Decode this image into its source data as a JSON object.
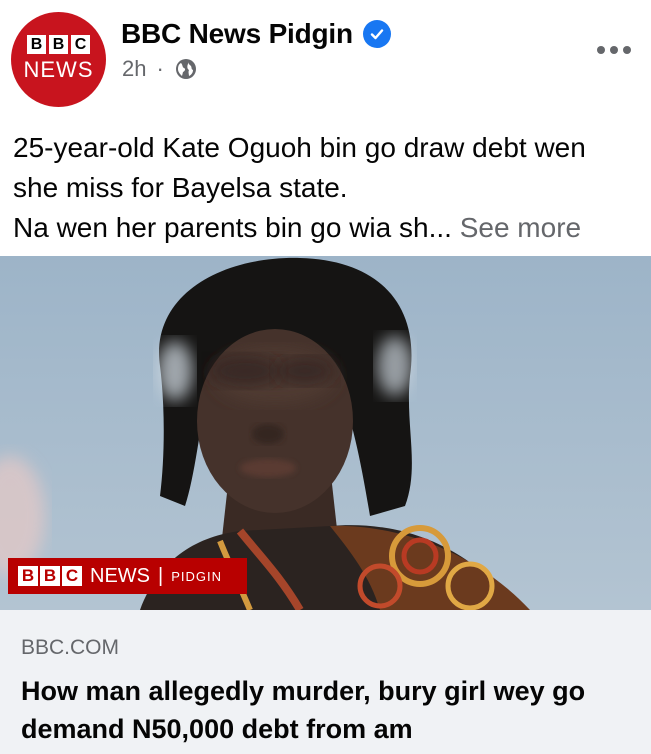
{
  "post": {
    "avatar": {
      "blocks": [
        "B",
        "B",
        "C"
      ],
      "news_text": "NEWS"
    },
    "page_name": "BBC News Pidgin",
    "time": "2h",
    "separator": "·",
    "privacy_icon": "globe-icon",
    "verified_icon": "verified-badge-icon",
    "more_icon": "more-options-icon",
    "text_lines": [
      "25-year-old Kate Oguoh bin go draw debt wen",
      "she miss for Bayelsa state.",
      "Na wen her parents bin go wia sh..."
    ],
    "see_more": "See more"
  },
  "media": {
    "overlay": {
      "blocks": [
        "B",
        "B",
        "C"
      ],
      "news": "NEWS",
      "divider": "|",
      "sub": "PIDGIN"
    }
  },
  "link_card": {
    "domain": "BBC.COM",
    "headline": "How man allegedly murder, bury girl wey go demand N50,000 debt from am"
  },
  "colors": {
    "bbc_red": "#c8141e",
    "verified_blue": "#1877f2",
    "secondary_text": "#65676b",
    "card_bg": "#f0f2f5"
  }
}
